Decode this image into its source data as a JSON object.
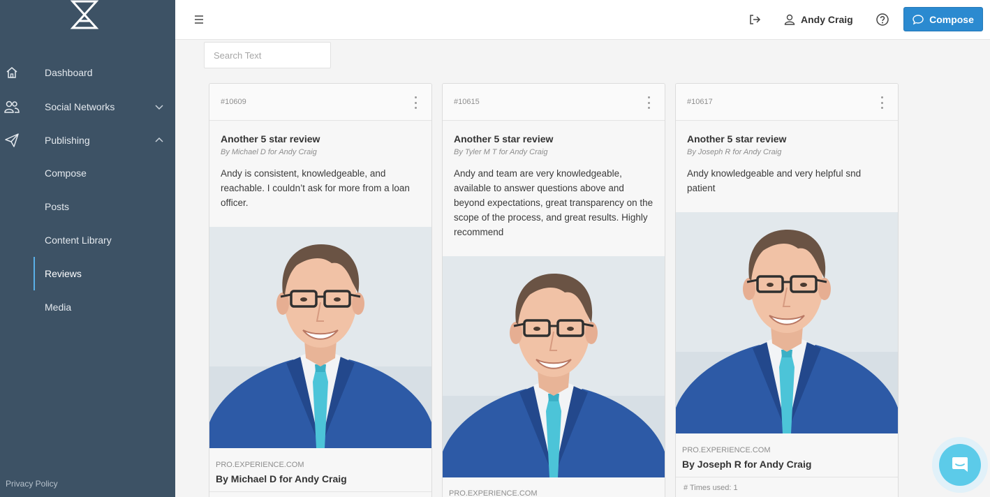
{
  "sidebar": {
    "nav": [
      {
        "label": "Dashboard",
        "icon": "home-icon"
      },
      {
        "label": "Social Networks",
        "icon": "users-icon"
      },
      {
        "label": "Publishing",
        "icon": "paper-plane-icon"
      }
    ],
    "sub_items": [
      {
        "label": "Compose"
      },
      {
        "label": "Posts"
      },
      {
        "label": "Content Library"
      },
      {
        "label": "Reviews"
      },
      {
        "label": "Media"
      }
    ],
    "active_item": "Reviews",
    "privacy_label": "Privacy Policy"
  },
  "header": {
    "user_name": "Andy Craig",
    "compose_label": "Compose"
  },
  "search": {
    "placeholder": "Search Text",
    "value": ""
  },
  "cards": [
    {
      "id": "#10609",
      "title": "Another 5 star review",
      "byline": "By Michael D for Andy Craig",
      "text": "Andy is consistent, knowledgeable, and reachable. I couldn’t ask for more from a loan officer.",
      "source": "PRO.EXPERIENCE.COM",
      "by_bold": "By Michael D for Andy Craig"
    },
    {
      "id": "#10615",
      "title": "Another 5 star review",
      "byline": "By Tyler M T for Andy Craig",
      "text": "Andy and team are very knowledgeable, available to answer questions above and beyond expectations, great transparency on the scope of the process, and great results. Highly recommend",
      "source": "PRO.EXPERIENCE.COM"
    },
    {
      "id": "#10617",
      "title": "Another 5 star review",
      "byline": "By Joseph R for Andy Craig",
      "text": "Andy knowledgeable and very helpful snd patient",
      "source": "PRO.EXPERIENCE.COM",
      "by_bold": "By Joseph R for Andy Craig",
      "times_used": "# Times used: 1"
    }
  ],
  "colors": {
    "sidebar_bg": "#3d5265",
    "accent": "#2b8ad0",
    "chat": "#5ccbe9"
  }
}
